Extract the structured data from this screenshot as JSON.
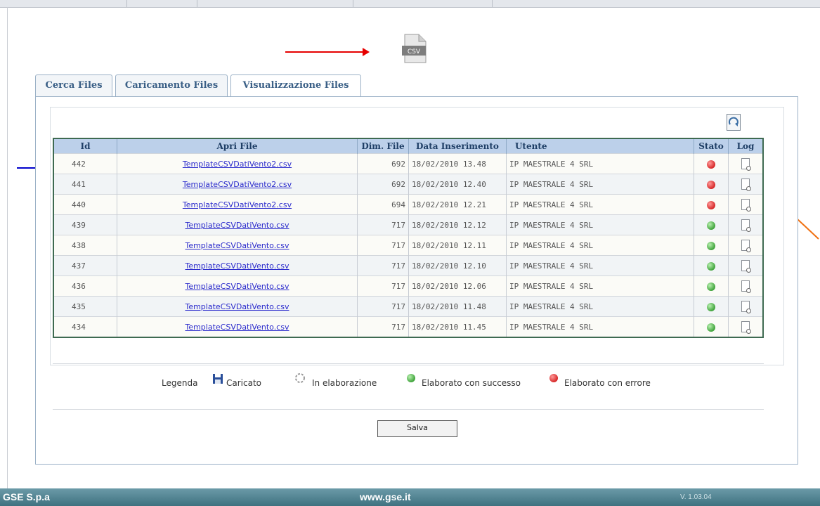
{
  "tabs": [
    "Cerca Files",
    "Caricamento Files",
    "Visualizzazione Files"
  ],
  "csv_icon_label": "CSV",
  "table": {
    "headers": [
      "Id",
      "Apri File",
      "Dim. File",
      "Data Inserimento",
      "Utente",
      "Stato",
      "Log"
    ],
    "rows": [
      {
        "id": "442",
        "file": "TemplateCSVDatiVento2.csv",
        "size": "692",
        "date": "18/02/2010 13.48",
        "user": "IP MAESTRALE 4 SRL",
        "status": "error"
      },
      {
        "id": "441",
        "file": "TemplateCSVDatiVento2.csv",
        "size": "692",
        "date": "18/02/2010 12.40",
        "user": "IP MAESTRALE 4 SRL",
        "status": "error"
      },
      {
        "id": "440",
        "file": "TemplateCSVDatiVento2.csv",
        "size": "694",
        "date": "18/02/2010 12.21",
        "user": "IP MAESTRALE 4 SRL",
        "status": "error"
      },
      {
        "id": "439",
        "file": "TemplateCSVDatiVento.csv",
        "size": "717",
        "date": "18/02/2010 12.12",
        "user": "IP MAESTRALE 4 SRL",
        "status": "success"
      },
      {
        "id": "438",
        "file": "TemplateCSVDatiVento.csv",
        "size": "717",
        "date": "18/02/2010 12.11",
        "user": "IP MAESTRALE 4 SRL",
        "status": "success"
      },
      {
        "id": "437",
        "file": "TemplateCSVDatiVento.csv",
        "size": "717",
        "date": "18/02/2010 12.10",
        "user": "IP MAESTRALE 4 SRL",
        "status": "success"
      },
      {
        "id": "436",
        "file": "TemplateCSVDatiVento.csv",
        "size": "717",
        "date": "18/02/2010 12.06",
        "user": "IP MAESTRALE 4 SRL",
        "status": "success"
      },
      {
        "id": "435",
        "file": "TemplateCSVDatiVento.csv",
        "size": "717",
        "date": "18/02/2010 11.48",
        "user": "IP MAESTRALE 4 SRL",
        "status": "success"
      },
      {
        "id": "434",
        "file": "TemplateCSVDatiVento.csv",
        "size": "717",
        "date": "18/02/2010 11.45",
        "user": "IP MAESTRALE 4 SRL",
        "status": "success"
      }
    ]
  },
  "legend": {
    "title": "Legenda",
    "caricato": "Caricato",
    "in_elaborazione": "In elaborazione",
    "successo": "Elaborato con successo",
    "errore": "Elaborato con errore"
  },
  "save_label": "Salva",
  "footer": {
    "left": "GSE S.p.a",
    "center": "www.gse.it",
    "version": "V. 1.03.04"
  },
  "colors": {
    "error": "#d62828",
    "success": "#3fa33b",
    "header": "#bcd0ea",
    "annot_red": "#e60000",
    "annot_blue": "#0000cc",
    "annot_green": "#117a11",
    "annot_magenta": "#e000e0",
    "annot_orange": "#f07010"
  }
}
